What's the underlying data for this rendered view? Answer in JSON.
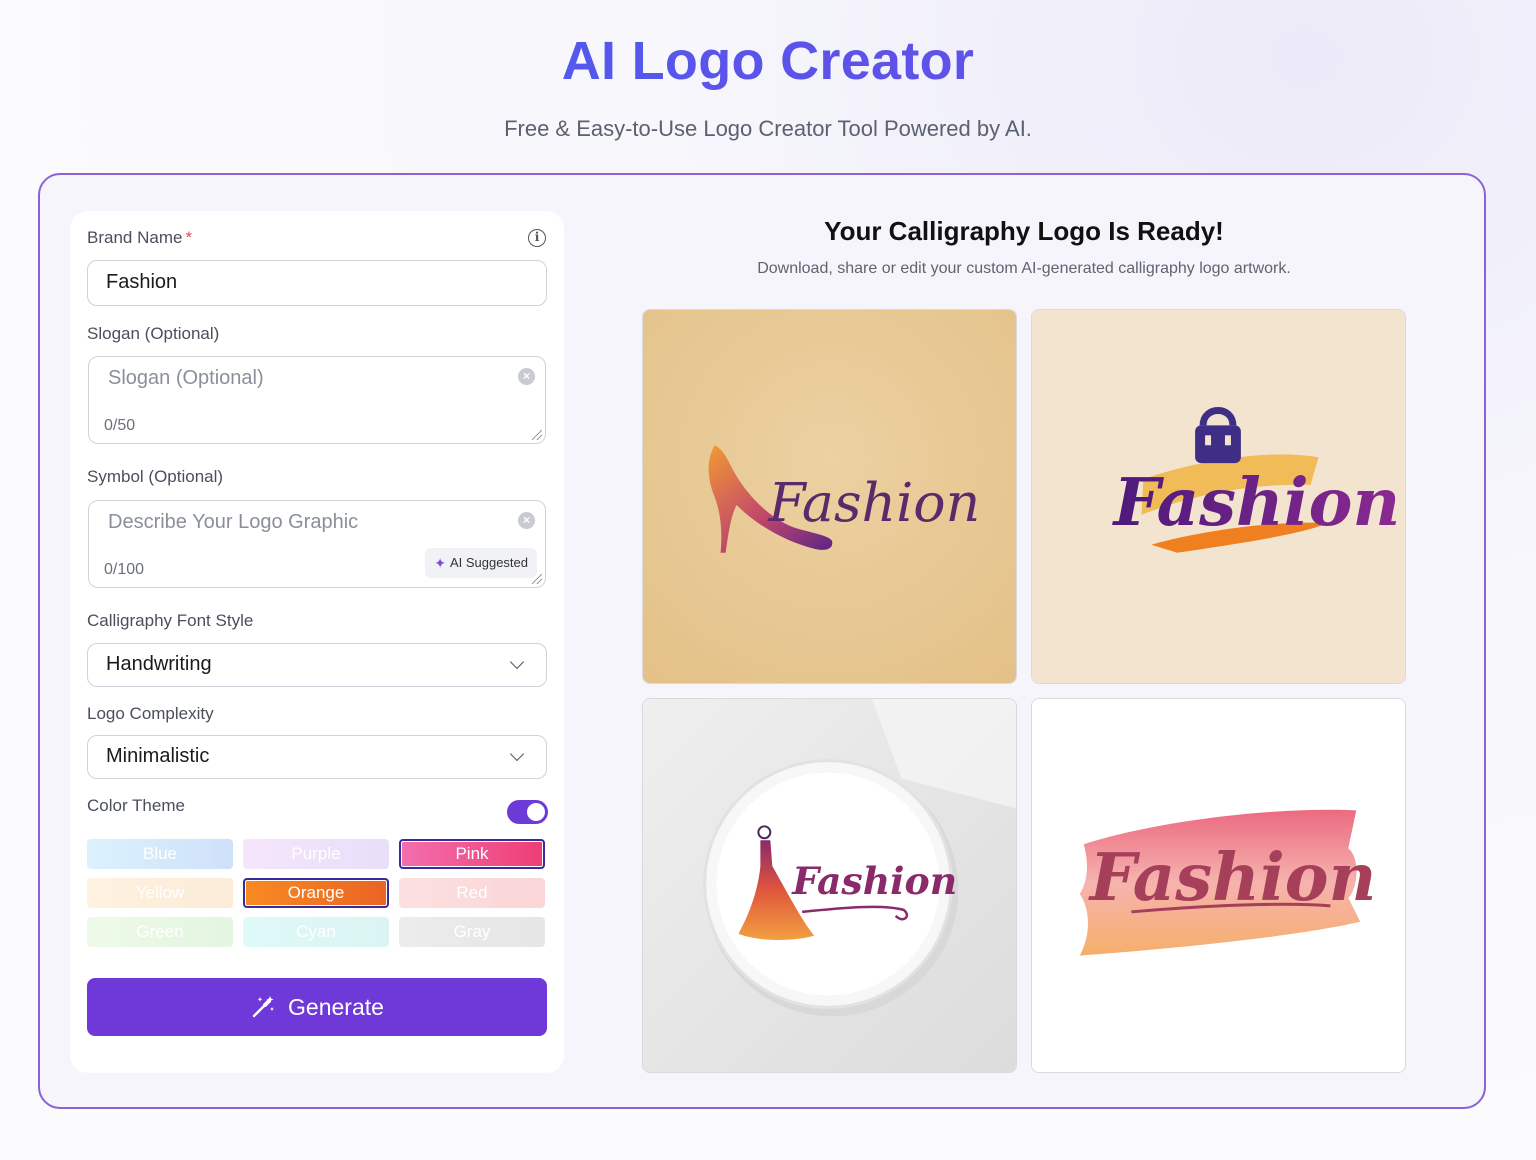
{
  "header": {
    "title": "AI Logo Creator",
    "subtitle": "Free & Easy-to-Use Logo Creator Tool Powered by AI."
  },
  "form": {
    "brand_name": {
      "label": "Brand Name",
      "required_mark": "*",
      "value": "Fashion",
      "info_icon": "info-icon"
    },
    "slogan": {
      "label": "Slogan (Optional)",
      "placeholder": "Slogan (Optional)",
      "counter": "0/50"
    },
    "symbol": {
      "label": "Symbol (Optional)",
      "placeholder": "Describe Your Logo Graphic",
      "counter": "0/100",
      "ai_button": "AI Suggested"
    },
    "font_style": {
      "label": "Calligraphy Font Style",
      "value": "Handwriting"
    },
    "complexity": {
      "label": "Logo Complexity",
      "value": "Minimalistic"
    },
    "color_theme": {
      "label": "Color Theme",
      "enabled": true,
      "swatches": [
        {
          "label": "Blue",
          "selected": false,
          "color_from": "#bfe6fb",
          "color_to": "#a8c9f5"
        },
        {
          "label": "Purple",
          "selected": false,
          "color_from": "#efd2fa",
          "color_to": "#d6c4f4"
        },
        {
          "label": "Pink",
          "selected": true,
          "color_from": "#f36fae",
          "color_to": "#ee3d74"
        },
        {
          "label": "Yellow",
          "selected": false,
          "color_from": "#fde7c6",
          "color_to": "#fbdcbb"
        },
        {
          "label": "Orange",
          "selected": true,
          "color_from": "#f88a22",
          "color_to": "#ea6425"
        },
        {
          "label": "Red",
          "selected": false,
          "color_from": "#fbc9c9",
          "color_to": "#f5b3b7"
        },
        {
          "label": "Green",
          "selected": false,
          "color_from": "#dff7d5",
          "color_to": "#cdeeca"
        },
        {
          "label": "Cyan",
          "selected": false,
          "color_from": "#c6f5f4",
          "color_to": "#bcece9"
        },
        {
          "label": "Gray",
          "selected": false,
          "color_from": "#dedede",
          "color_to": "#d1d1d1"
        }
      ]
    },
    "generate_label": "Generate"
  },
  "results": {
    "title": "Your Calligraphy Logo Is Ready!",
    "subtitle": "Download, share or edit your custom AI-generated calligraphy logo artwork.",
    "logos": [
      {
        "text": "Fashion",
        "symbol": "high-heel-shoe",
        "background": "#e6c68d"
      },
      {
        "text": "Fashion",
        "symbol": "handbag",
        "background": "#f2e3cf"
      },
      {
        "text": "Fashion",
        "symbol": "dress-silhouette",
        "background": "#ececec"
      },
      {
        "text": "Fashion",
        "symbol": "paint-brush-stroke",
        "background": "#ffffff"
      }
    ]
  },
  "colors": {
    "accent": "#6f38d8",
    "title_gradient_from": "#3d6cf0",
    "title_gradient_to": "#6c4ce6",
    "card_border": "#8b62d8"
  }
}
